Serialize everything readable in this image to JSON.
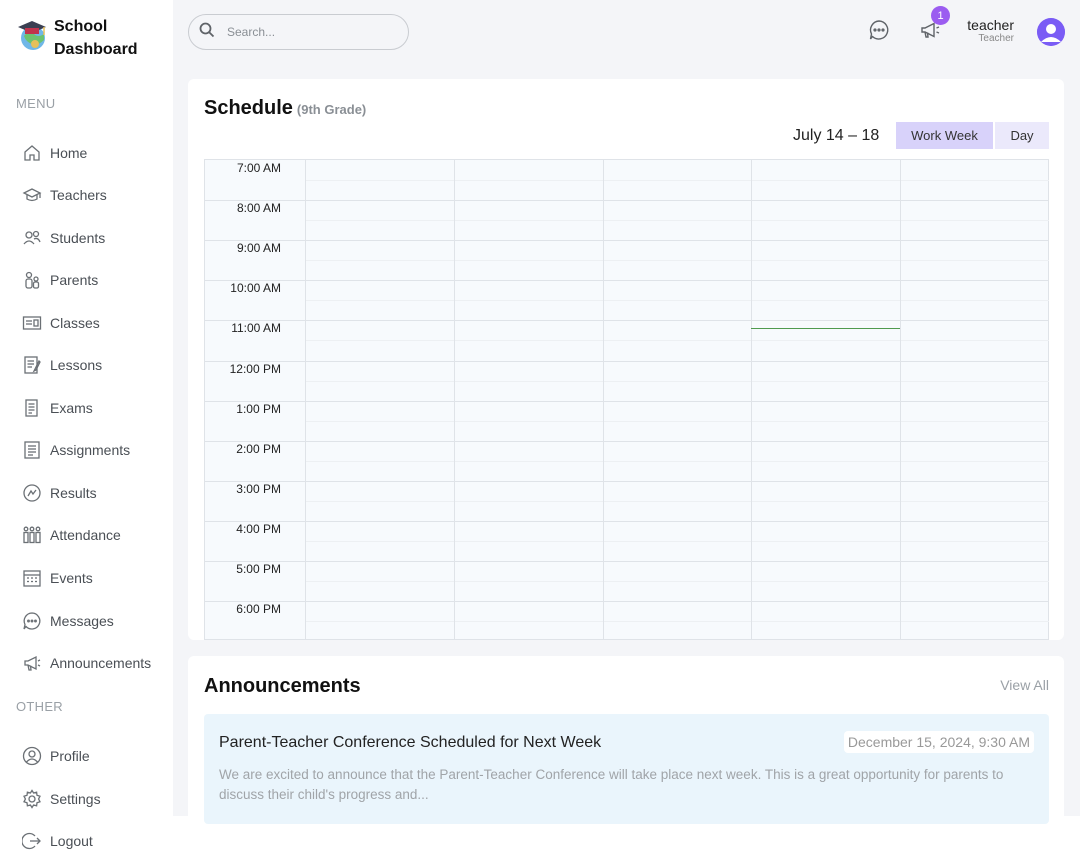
{
  "brand": {
    "title_line1": "School",
    "title_line2": "Dashboard"
  },
  "sidebar": {
    "menu_title": "MENU",
    "other_title": "OTHER",
    "items": [
      {
        "label": "Home",
        "icon": "home-icon"
      },
      {
        "label": "Teachers",
        "icon": "teacher-icon"
      },
      {
        "label": "Students",
        "icon": "students-icon"
      },
      {
        "label": "Parents",
        "icon": "parents-icon"
      },
      {
        "label": "Classes",
        "icon": "classes-icon"
      },
      {
        "label": "Lessons",
        "icon": "lessons-icon"
      },
      {
        "label": "Exams",
        "icon": "exams-icon"
      },
      {
        "label": "Assignments",
        "icon": "assignments-icon"
      },
      {
        "label": "Results",
        "icon": "results-icon"
      },
      {
        "label": "Attendance",
        "icon": "attendance-icon"
      },
      {
        "label": "Events",
        "icon": "events-icon"
      },
      {
        "label": "Messages",
        "icon": "messages-icon"
      },
      {
        "label": "Announcements",
        "icon": "announcements-icon"
      }
    ],
    "other_items": [
      {
        "label": "Profile",
        "icon": "profile-icon"
      },
      {
        "label": "Settings",
        "icon": "settings-icon"
      },
      {
        "label": "Logout",
        "icon": "logout-icon"
      }
    ]
  },
  "topbar": {
    "search_placeholder": "Search...",
    "notification_count": "1",
    "user_name": "teacher",
    "user_role": "Teacher"
  },
  "schedule": {
    "title": "Schedule",
    "subtitle": "(9th Grade)",
    "date_range": "July 14 – 18",
    "views": {
      "work_week": "Work Week",
      "day": "Day"
    },
    "active_view": "work_week",
    "times": [
      "7:00 AM",
      "8:00 AM",
      "9:00 AM",
      "10:00 AM",
      "11:00 AM",
      "12:00 PM",
      "1:00 PM",
      "2:00 PM",
      "3:00 PM",
      "4:00 PM",
      "5:00 PM",
      "6:00 PM"
    ],
    "day_count": 5,
    "current_time_day_index": 3,
    "current_time_hours_from_start": 4.2,
    "current_time_color": "#4f9a4f"
  },
  "announcements": {
    "title": "Announcements",
    "view_all": "View All",
    "items": [
      {
        "title": "Parent-Teacher Conference Scheduled for Next Week",
        "date": "December 15, 2024, 9:30 AM",
        "body": "We are excited to announce that the Parent-Teacher Conference will take place next week. This is a great opportunity for parents to discuss their child's progress and..."
      }
    ]
  },
  "colors": {
    "accent": "#9b5cf0",
    "active_view_bg": "#d8d2fa",
    "announcement_bg": "#eaf5fc"
  }
}
